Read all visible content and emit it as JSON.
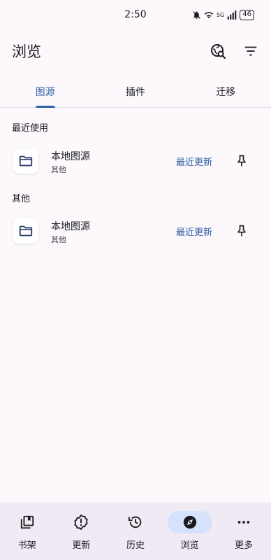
{
  "status_bar": {
    "time": "2:50",
    "signal": "5G",
    "battery": "46"
  },
  "app_bar": {
    "title": "浏览"
  },
  "tabs": [
    {
      "label": "图源",
      "active": true
    },
    {
      "label": "插件",
      "active": false
    },
    {
      "label": "迁移",
      "active": false
    }
  ],
  "sections": [
    {
      "header": "最近使用",
      "sources": [
        {
          "name": "本地图源",
          "lang": "其他",
          "action": "最近更新"
        }
      ]
    },
    {
      "header": "其他",
      "sources": [
        {
          "name": "本地图源",
          "lang": "其他",
          "action": "最近更新"
        }
      ]
    }
  ],
  "bottom_nav": [
    {
      "label": "书架",
      "icon": "library-icon",
      "active": false
    },
    {
      "label": "更新",
      "icon": "updates-icon",
      "active": false
    },
    {
      "label": "历史",
      "icon": "history-icon",
      "active": false
    },
    {
      "label": "浏览",
      "icon": "explore-icon",
      "active": true
    },
    {
      "label": "更多",
      "icon": "more-icon",
      "active": false
    }
  ],
  "colors": {
    "accent": "#2f5fa5",
    "background": "#fcf8fc",
    "nav_bg": "#efeaf3",
    "active_pill": "#d6e2fb"
  }
}
